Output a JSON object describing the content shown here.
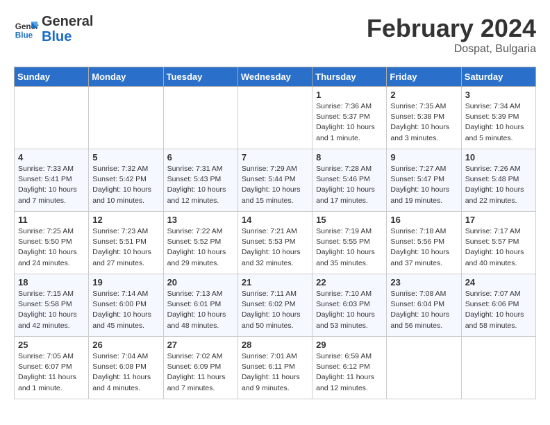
{
  "header": {
    "logo_general": "General",
    "logo_blue": "Blue",
    "month": "February 2024",
    "location": "Dospat, Bulgaria"
  },
  "days_of_week": [
    "Sunday",
    "Monday",
    "Tuesday",
    "Wednesday",
    "Thursday",
    "Friday",
    "Saturday"
  ],
  "weeks": [
    [
      {
        "day": "",
        "info": ""
      },
      {
        "day": "",
        "info": ""
      },
      {
        "day": "",
        "info": ""
      },
      {
        "day": "",
        "info": ""
      },
      {
        "day": "1",
        "info": "Sunrise: 7:36 AM\nSunset: 5:37 PM\nDaylight: 10 hours and 1 minute."
      },
      {
        "day": "2",
        "info": "Sunrise: 7:35 AM\nSunset: 5:38 PM\nDaylight: 10 hours and 3 minutes."
      },
      {
        "day": "3",
        "info": "Sunrise: 7:34 AM\nSunset: 5:39 PM\nDaylight: 10 hours and 5 minutes."
      }
    ],
    [
      {
        "day": "4",
        "info": "Sunrise: 7:33 AM\nSunset: 5:41 PM\nDaylight: 10 hours and 7 minutes."
      },
      {
        "day": "5",
        "info": "Sunrise: 7:32 AM\nSunset: 5:42 PM\nDaylight: 10 hours and 10 minutes."
      },
      {
        "day": "6",
        "info": "Sunrise: 7:31 AM\nSunset: 5:43 PM\nDaylight: 10 hours and 12 minutes."
      },
      {
        "day": "7",
        "info": "Sunrise: 7:29 AM\nSunset: 5:44 PM\nDaylight: 10 hours and 15 minutes."
      },
      {
        "day": "8",
        "info": "Sunrise: 7:28 AM\nSunset: 5:46 PM\nDaylight: 10 hours and 17 minutes."
      },
      {
        "day": "9",
        "info": "Sunrise: 7:27 AM\nSunset: 5:47 PM\nDaylight: 10 hours and 19 minutes."
      },
      {
        "day": "10",
        "info": "Sunrise: 7:26 AM\nSunset: 5:48 PM\nDaylight: 10 hours and 22 minutes."
      }
    ],
    [
      {
        "day": "11",
        "info": "Sunrise: 7:25 AM\nSunset: 5:50 PM\nDaylight: 10 hours and 24 minutes."
      },
      {
        "day": "12",
        "info": "Sunrise: 7:23 AM\nSunset: 5:51 PM\nDaylight: 10 hours and 27 minutes."
      },
      {
        "day": "13",
        "info": "Sunrise: 7:22 AM\nSunset: 5:52 PM\nDaylight: 10 hours and 29 minutes."
      },
      {
        "day": "14",
        "info": "Sunrise: 7:21 AM\nSunset: 5:53 PM\nDaylight: 10 hours and 32 minutes."
      },
      {
        "day": "15",
        "info": "Sunrise: 7:19 AM\nSunset: 5:55 PM\nDaylight: 10 hours and 35 minutes."
      },
      {
        "day": "16",
        "info": "Sunrise: 7:18 AM\nSunset: 5:56 PM\nDaylight: 10 hours and 37 minutes."
      },
      {
        "day": "17",
        "info": "Sunrise: 7:17 AM\nSunset: 5:57 PM\nDaylight: 10 hours and 40 minutes."
      }
    ],
    [
      {
        "day": "18",
        "info": "Sunrise: 7:15 AM\nSunset: 5:58 PM\nDaylight: 10 hours and 42 minutes."
      },
      {
        "day": "19",
        "info": "Sunrise: 7:14 AM\nSunset: 6:00 PM\nDaylight: 10 hours and 45 minutes."
      },
      {
        "day": "20",
        "info": "Sunrise: 7:13 AM\nSunset: 6:01 PM\nDaylight: 10 hours and 48 minutes."
      },
      {
        "day": "21",
        "info": "Sunrise: 7:11 AM\nSunset: 6:02 PM\nDaylight: 10 hours and 50 minutes."
      },
      {
        "day": "22",
        "info": "Sunrise: 7:10 AM\nSunset: 6:03 PM\nDaylight: 10 hours and 53 minutes."
      },
      {
        "day": "23",
        "info": "Sunrise: 7:08 AM\nSunset: 6:04 PM\nDaylight: 10 hours and 56 minutes."
      },
      {
        "day": "24",
        "info": "Sunrise: 7:07 AM\nSunset: 6:06 PM\nDaylight: 10 hours and 58 minutes."
      }
    ],
    [
      {
        "day": "25",
        "info": "Sunrise: 7:05 AM\nSunset: 6:07 PM\nDaylight: 11 hours and 1 minute."
      },
      {
        "day": "26",
        "info": "Sunrise: 7:04 AM\nSunset: 6:08 PM\nDaylight: 11 hours and 4 minutes."
      },
      {
        "day": "27",
        "info": "Sunrise: 7:02 AM\nSunset: 6:09 PM\nDaylight: 11 hours and 7 minutes."
      },
      {
        "day": "28",
        "info": "Sunrise: 7:01 AM\nSunset: 6:11 PM\nDaylight: 11 hours and 9 minutes."
      },
      {
        "day": "29",
        "info": "Sunrise: 6:59 AM\nSunset: 6:12 PM\nDaylight: 11 hours and 12 minutes."
      },
      {
        "day": "",
        "info": ""
      },
      {
        "day": "",
        "info": ""
      }
    ]
  ]
}
